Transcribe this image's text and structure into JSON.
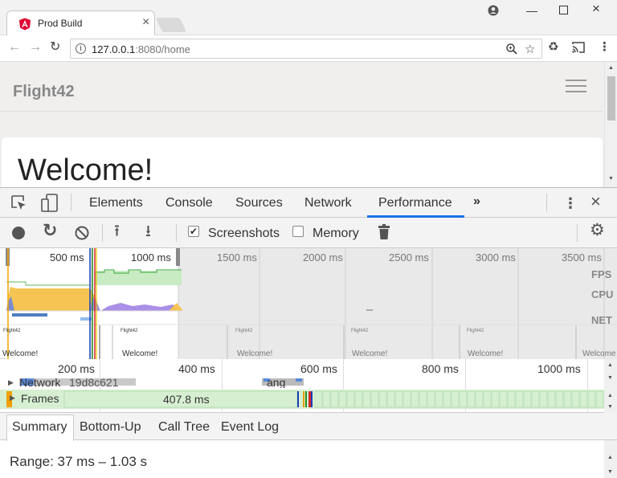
{
  "browser": {
    "tab_title": "Prod Build",
    "url_host": "127.0.0.1",
    "url_rest": ":8080/home",
    "icons": {
      "favicon": "angular-shield-icon",
      "close": "close-icon",
      "account": "account-icon",
      "minimize": "minimize-icon",
      "maximize": "maximize-icon",
      "window_close": "window-close-icon",
      "back": "back-arrow-icon",
      "forward": "forward-arrow-icon",
      "reload": "reload-icon",
      "info": "info-icon",
      "zoom": "zoom-icon",
      "bookmark": "star-icon",
      "extension": "recycle-icon",
      "cast": "cast-icon",
      "menu": "kebab-menu-icon"
    },
    "favicon_color": "#dd0031"
  },
  "page": {
    "brand": "Flight42",
    "heading": "Welcome!"
  },
  "devtools": {
    "tabs": [
      "Elements",
      "Console",
      "Sources",
      "Network",
      "Performance"
    ],
    "active_tab": "Performance",
    "more": "»",
    "accent_color": "#1a73e8",
    "toolbar": {
      "screenshots_label": "Screenshots",
      "screenshots_checked": true,
      "memory_label": "Memory",
      "memory_checked": false
    },
    "overview": {
      "ticks": [
        "500 ms",
        "1000 ms",
        "1500 ms",
        "2000 ms",
        "2500 ms",
        "3000 ms",
        "3500 ms"
      ],
      "lanes": [
        "FPS",
        "CPU",
        "NET"
      ],
      "screenshot_titles": [
        "Flight42",
        "Flight42",
        "Flight42",
        "Flight42",
        "Flight42",
        "Flight42"
      ],
      "screenshot_texts": [
        "Welcome!",
        "Welcome!",
        "Welcome!",
        "Welcome!",
        "Welcome!",
        "Welcome"
      ]
    },
    "flame": {
      "ticks": [
        "200 ms",
        "400 ms",
        "600 ms",
        "800 ms",
        "1000 ms"
      ],
      "network_label": "Network",
      "network_text": "19d8c621",
      "network_text2": "ang",
      "frames_label": "Frames",
      "frames_duration": "407.8 ms"
    },
    "bottom": {
      "tabs": [
        "Summary",
        "Bottom-Up",
        "Call Tree",
        "Event Log"
      ],
      "active_tab": "Summary",
      "range": "Range: 37 ms – 1.03 s"
    }
  }
}
